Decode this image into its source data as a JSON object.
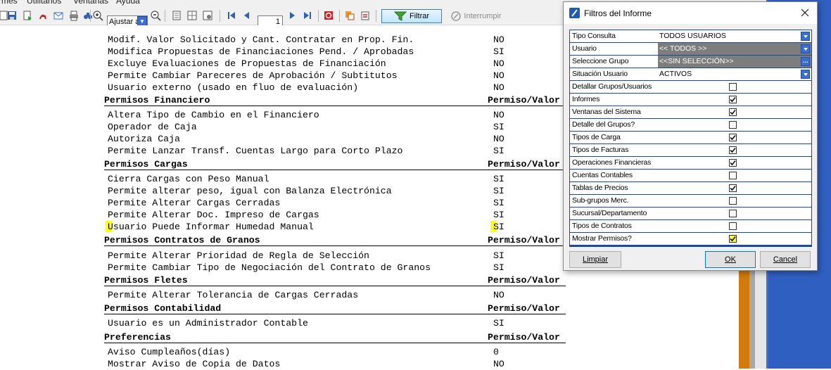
{
  "menu": {
    "items": [
      "rmes",
      "Utilitarios",
      "Ventanas",
      "Ayuda"
    ]
  },
  "toolbar": {
    "zoom_value": "Ajustar a",
    "page_number": "1",
    "filter_label": "Filtrar",
    "interrupt_label": "Interrumpir"
  },
  "report": {
    "rows": [
      {
        "type": "item",
        "label": "Modif. Valor Solicitado y Cant. Contratar en Prop. Fin.",
        "value": "NO"
      },
      {
        "type": "item",
        "label": "Modifica Propuestas de Financiaciones Pend. / Aprobadas",
        "value": "SI"
      },
      {
        "type": "item",
        "label": "Excluye Evaluaciones de Propuestas de Financiación",
        "value": "NO"
      },
      {
        "type": "item",
        "label": "Permite Cambiar Pareceres de Aprobación / Subtitutos",
        "value": "NO"
      },
      {
        "type": "item",
        "label": "Usuario externo (usado en fluo de evaluación)",
        "value": "NO"
      },
      {
        "type": "section",
        "label": "Permisos Financiero",
        "value": "Permiso/Valor"
      },
      {
        "type": "item",
        "label": "Altera Tipo de Cambio en el Financiero",
        "value": "NO"
      },
      {
        "type": "item",
        "label": "Operador de Caja",
        "value": "SI"
      },
      {
        "type": "item",
        "label": "Autoriza Caja",
        "value": "NO"
      },
      {
        "type": "item",
        "label": "Permite Lanzar Transf. Cuentas Largo para Corto Plazo",
        "value": "SI"
      },
      {
        "type": "section",
        "label": "Permisos Cargas",
        "value": "Permiso/Valor"
      },
      {
        "type": "item",
        "label": "Cierra Cargas con Peso Manual",
        "value": "SI"
      },
      {
        "type": "item",
        "label": "Permite alterar peso, igual con Balanza Electrónica",
        "value": "SI"
      },
      {
        "type": "item",
        "label": "Permite Alterar Cargas Cerradas",
        "value": "SI"
      },
      {
        "type": "item",
        "label": "Permite Alterar Doc. Impreso de Cargas",
        "value": "SI"
      },
      {
        "type": "item",
        "label": "Usuario Puede Informar Humedad Manual",
        "value": "SI",
        "highlight": true
      },
      {
        "type": "section",
        "label": "Permisos Contratos de Granos",
        "value": "Permiso/Valor"
      },
      {
        "type": "item",
        "label": "Permite Alterar Prioridad de Regla de Selección",
        "value": "SI"
      },
      {
        "type": "item",
        "label": "Permite Cambiar Tipo de Negociación del Contrato de Granos",
        "value": "SI"
      },
      {
        "type": "section",
        "label": "Permisos Fletes",
        "value": "Permiso/Valor"
      },
      {
        "type": "item",
        "label": "Permite Alterar Tolerancia de Cargas Cerradas",
        "value": "NO"
      },
      {
        "type": "section",
        "label": "Permisos Contabilidad",
        "value": "Permiso/Valor"
      },
      {
        "type": "item",
        "label": "Usuario es un Administrador Contable",
        "value": "SI"
      },
      {
        "type": "section",
        "label": "Preferencias",
        "value": "Permiso/Valor"
      },
      {
        "type": "item",
        "label": "Aviso Cumpleaños(días)",
        "value": "0"
      },
      {
        "type": "item",
        "label": "Mostrar Aviso de Copia de Datos",
        "value": "NO"
      }
    ]
  },
  "dialog": {
    "title": "Filtros del Informe",
    "filters": [
      {
        "label": "Tipo Consulta",
        "value": "TODOS USUARIOS",
        "kind": "dropdown"
      },
      {
        "label": "Usuario",
        "value": "<< TODOS >>",
        "kind": "dropdown",
        "dark": true
      },
      {
        "label": "Seleccione Grupo",
        "value": "<<SIN SELECCIÓN>>",
        "kind": "picker",
        "dark": true
      },
      {
        "label": "Situación Usuario",
        "value": "ACTIVOS",
        "kind": "dropdown"
      },
      {
        "label": "Detallar Grupos/Usuarios",
        "checked": false,
        "kind": "check"
      },
      {
        "label": "Informes",
        "checked": true,
        "kind": "check"
      },
      {
        "label": "Ventanas del Sistema",
        "checked": true,
        "kind": "check"
      },
      {
        "label": "Detalle del Grupos?",
        "checked": false,
        "kind": "check"
      },
      {
        "label": "Tipos de Carga",
        "checked": true,
        "kind": "check"
      },
      {
        "label": "Tipos de Facturas",
        "checked": true,
        "kind": "check"
      },
      {
        "label": "Operaciones Financieras",
        "checked": true,
        "kind": "check"
      },
      {
        "label": "Cuentas Contables",
        "checked": false,
        "kind": "check"
      },
      {
        "label": "Tablas de Precios",
        "checked": true,
        "kind": "check"
      },
      {
        "label": "Sub-grupos Merc.",
        "checked": false,
        "kind": "check"
      },
      {
        "label": "Sucursal/Departamento",
        "checked": false,
        "kind": "check"
      },
      {
        "label": "Tipos de Contratos",
        "checked": false,
        "kind": "check"
      },
      {
        "label": "Mostrar Permisos?",
        "checked": true,
        "kind": "check",
        "highlight": true
      }
    ],
    "buttons": {
      "clear": "Limpiar",
      "ok": "OK",
      "cancel": "Cancel"
    }
  },
  "colors": {
    "accent": "#3a6fd1",
    "highlight": "#ffff1a",
    "side_blue": "#2f5fc1",
    "orange": "#d27a0a"
  }
}
